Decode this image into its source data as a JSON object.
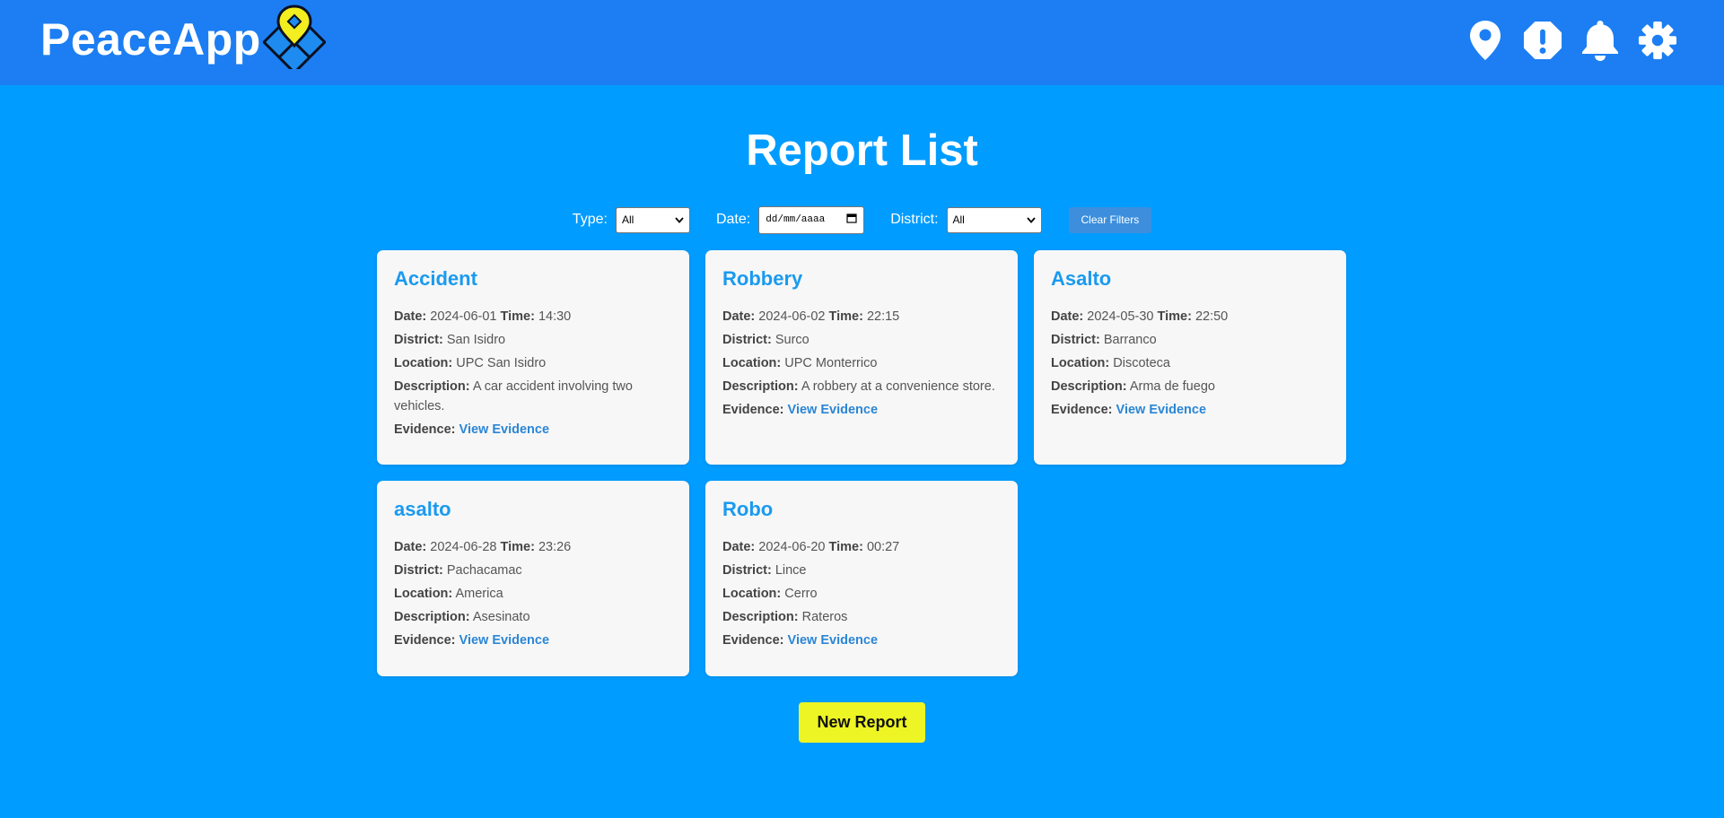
{
  "brand": {
    "name": "PeaceApp",
    "logo_icon": "map-pin-diamond-logo"
  },
  "nav": {
    "icons": [
      "map-pin-icon",
      "alert-icon",
      "bell-icon",
      "gear-icon"
    ]
  },
  "page": {
    "title": "Report List"
  },
  "filters": {
    "type_label": "Type:",
    "type_value": "All",
    "date_label": "Date:",
    "date_placeholder": "dd/mm/aaaa",
    "district_label": "District:",
    "district_value": "All",
    "clear_label": "Clear Filters"
  },
  "labels": {
    "date": "Date:",
    "time": "Time:",
    "district": "District:",
    "location": "Location:",
    "description": "Description:",
    "evidence": "Evidence:",
    "view_evidence": "View Evidence"
  },
  "reports": [
    {
      "title": "Accident",
      "date": "2024-06-01",
      "time": "14:30",
      "district": "San Isidro",
      "location": "UPC San Isidro",
      "description": "A car accident involving two vehicles."
    },
    {
      "title": "Robbery",
      "date": "2024-06-02",
      "time": "22:15",
      "district": "Surco",
      "location": "UPC Monterrico",
      "description": "A robbery at a convenience store."
    },
    {
      "title": "Asalto",
      "date": "2024-05-30",
      "time": "22:50",
      "district": "Barranco",
      "location": "Discoteca",
      "description": "Arma de fuego"
    },
    {
      "title": "asalto",
      "date": "2024-06-28",
      "time": "23:26",
      "district": "Pachacamac",
      "location": "America",
      "description": "Asesinato"
    },
    {
      "title": "Robo",
      "date": "2024-06-20",
      "time": "00:27",
      "district": "Lince",
      "location": "Cerro",
      "description": "Rateros"
    }
  ],
  "actions": {
    "new_report_label": "New Report"
  },
  "colors": {
    "page_bg": "#019cff",
    "topbar_bg": "#1c7ef2",
    "card_title": "#1a9af0",
    "link": "#2b86d6",
    "new_report_bg": "#eef524",
    "logo_yellow": "#f2ee1f",
    "logo_blue": "#1d8bf0"
  }
}
